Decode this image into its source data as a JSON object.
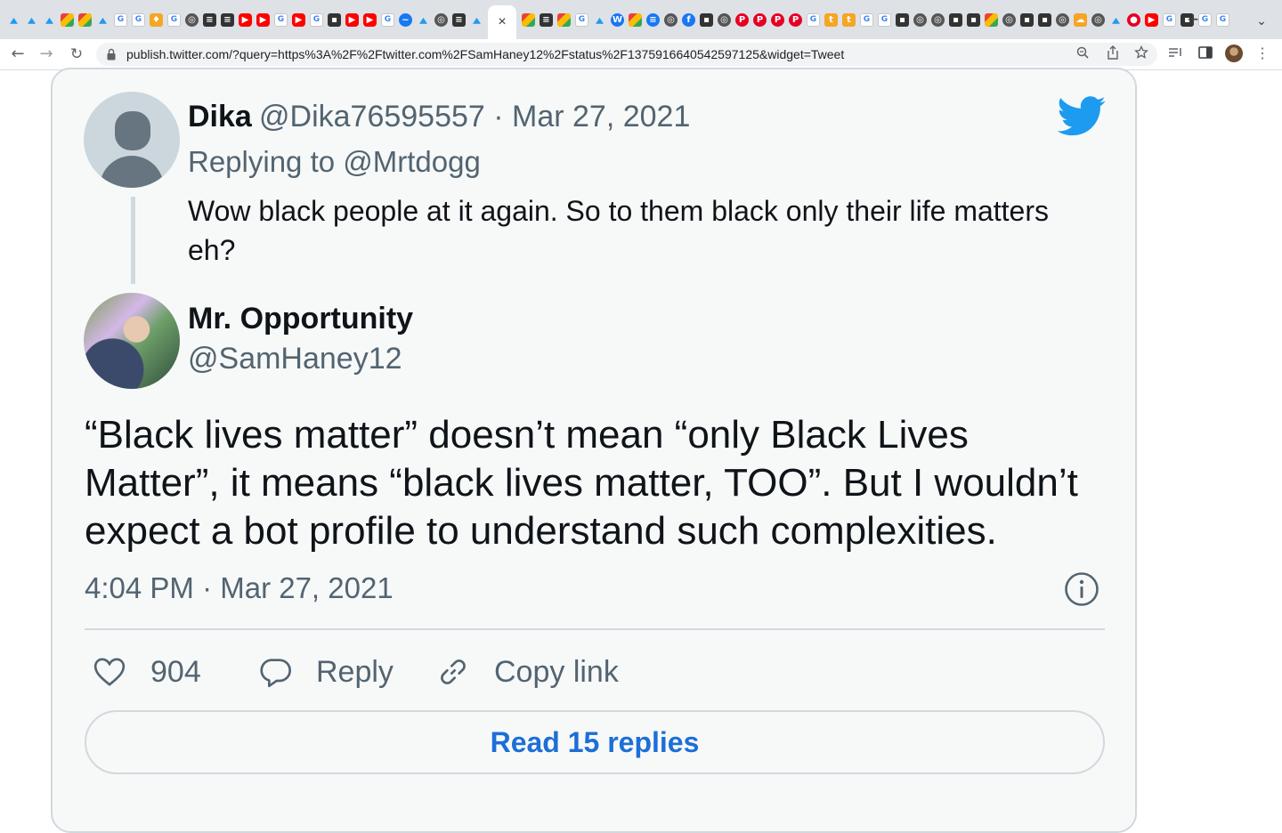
{
  "browser": {
    "url": "publish.twitter.com/?query=https%3A%2F%2Ftwitter.com%2FSamHaney12%2Fstatus%2F1375916640542597125&widget=Tweet",
    "active_tab_close": "×",
    "new_tab": "+",
    "tab_menu": "⌄",
    "tab_icons": [
      "twitter-icon",
      "twitter-icon",
      "twitter-icon",
      "photos-icon",
      "photos-icon",
      "twitter-icon",
      "google-icon",
      "google-icon",
      "shield-icon",
      "google-icon",
      "globe-icon",
      "news-icon",
      "news-icon",
      "youtube-icon",
      "youtube-icon",
      "google-icon",
      "youtube-icon",
      "google-icon",
      "app-icon",
      "youtube-icon",
      "youtube-icon",
      "google-icon",
      "chart-icon",
      "twitter-icon",
      "globe-icon",
      "news-icon",
      "twitter-icon"
    ],
    "tab_icons_right": [
      "maps-icon",
      "news-icon",
      "maps-icon",
      "google-icon",
      "twitter-icon",
      "word-icon",
      "maps-icon",
      "doc-icon",
      "globe-icon",
      "facebook-icon",
      "app-icon",
      "globe-icon",
      "pinterest-icon",
      "pinterest-icon",
      "pinterest-icon",
      "pinterest-icon",
      "google-icon",
      "tumblr-icon",
      "tumblr-icon",
      "google-icon",
      "google-icon",
      "app-icon",
      "globe-icon",
      "globe-icon",
      "app-icon",
      "app-icon",
      "maps-icon",
      "globe-icon",
      "app-icon",
      "app-icon",
      "globe-icon",
      "soundcloud-icon",
      "globe-icon",
      "twitter-icon",
      "reddit-icon",
      "youtube-icon",
      "google-icon",
      "app-icon",
      "google-icon",
      "google-icon"
    ]
  },
  "tweet": {
    "parent": {
      "name": "Dika",
      "handle_date": "@Dika76595557 · Mar 27, 2021",
      "replying_to": "Replying to @Mrtdogg",
      "text": "Wow black people at it again. So to them black only their life matters eh?"
    },
    "author": {
      "name": "Mr. Opportunity",
      "handle": "@SamHaney12"
    },
    "text": "“Black lives matter” doesn’t mean “only Black Lives Matter”, it means “black lives matter, TOO”. But I wouldn’t expect a bot profile to understand such complexities.",
    "timestamp": "4:04 PM · Mar 27, 2021",
    "actions": {
      "likes": "904",
      "reply": "Reply",
      "copy_link": "Copy link"
    },
    "read_replies": "Read 15 replies"
  },
  "colors": {
    "brand": "#1d9bf0",
    "link": "#1d6fd6",
    "secondary_text": "#536471",
    "border": "#cfd9de"
  }
}
